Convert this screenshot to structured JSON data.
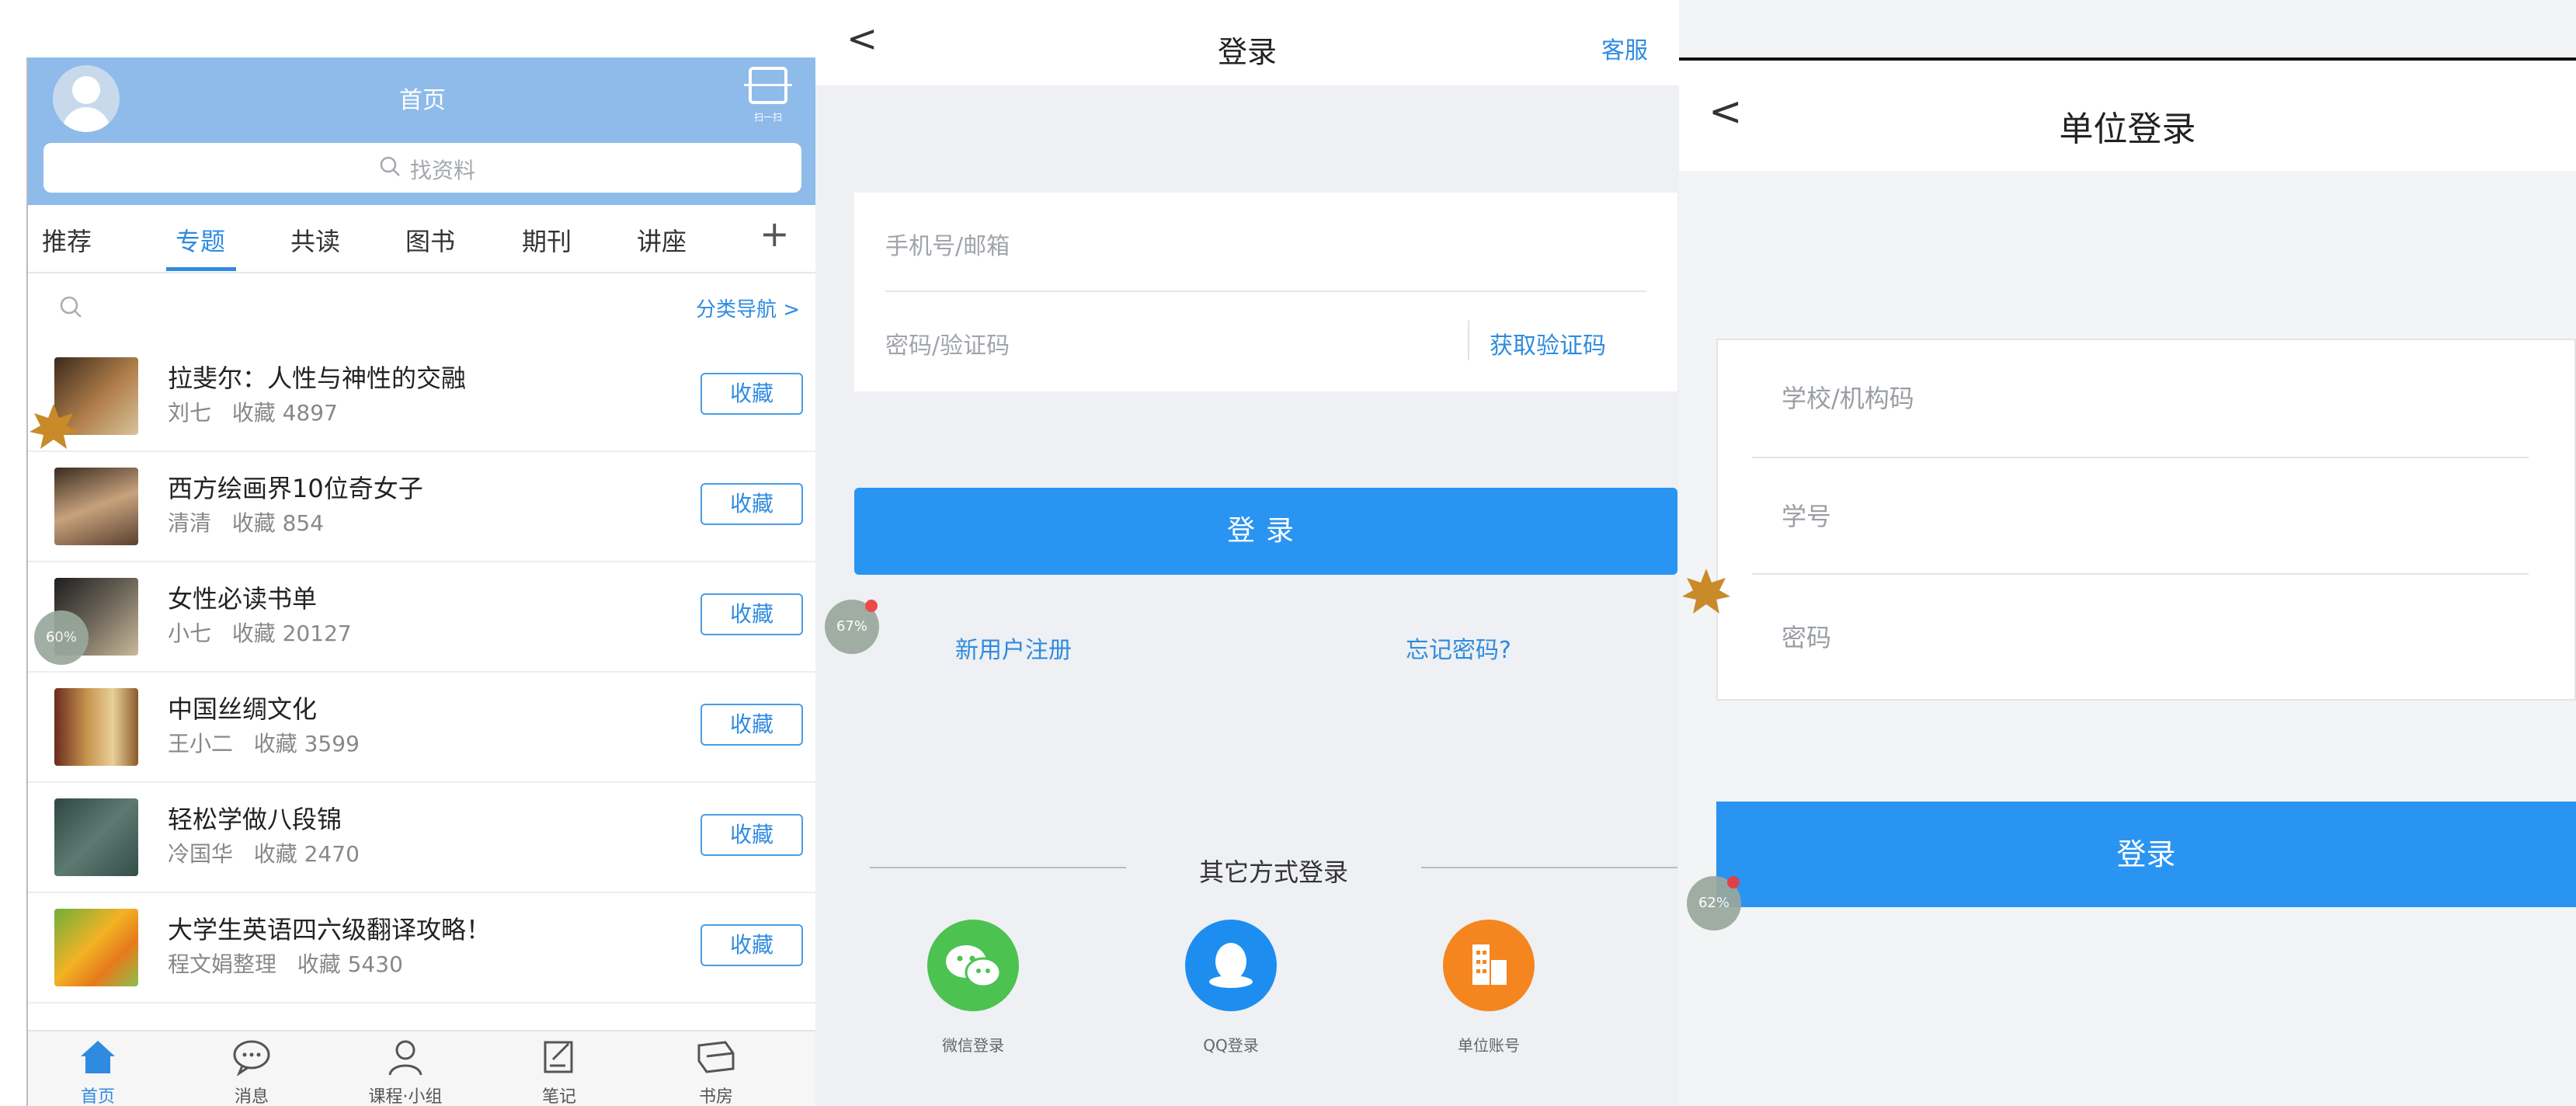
{
  "home": {
    "title": "首页",
    "scan_label": "扫一扫",
    "search_placeholder": "找资料",
    "tabs": [
      "推荐",
      "专题",
      "共读",
      "图书",
      "期刊",
      "讲座"
    ],
    "active_tab": "专题",
    "category_nav": "分类导航 >",
    "items": [
      {
        "title": "拉斐尔：人性与神性的交融",
        "author": "刘七",
        "favorites": "收藏 4897",
        "button": "收藏",
        "thumb_color": "#6b4a2e"
      },
      {
        "title": "西方绘画界10位奇女子",
        "author": "清清",
        "favorites": "收藏 854",
        "button": "收藏",
        "thumb_color": "#8a6b4c"
      },
      {
        "title": "女性必读书单",
        "author": "小七",
        "favorites": "收藏 20127",
        "button": "收藏",
        "thumb_color": "#3c3c3c"
      },
      {
        "title": "中国丝绸文化",
        "author": "王小二",
        "favorites": "收藏 3599",
        "button": "收藏",
        "thumb_color": "#9c6a3a"
      },
      {
        "title": "轻松学做八段锦",
        "author": "冷国华",
        "favorites": "收藏 2470",
        "button": "收藏",
        "thumb_color": "#3f5c56"
      },
      {
        "title": "大学生英语四六级翻译攻略！",
        "author": "程文娟整理",
        "favorites": "收藏 5430",
        "button": "收藏",
        "thumb_color": "#e6a02a"
      }
    ],
    "bottom_nav": [
      "首页",
      "消息",
      "课程·小组",
      "笔记",
      "书房"
    ],
    "bubble_text": "60%"
  },
  "login": {
    "back": "<",
    "title": "登录",
    "service": "客服",
    "phone_placeholder": "手机号/邮箱",
    "password_placeholder": "密码/验证码",
    "get_code": "获取验证码",
    "login_button": "登录",
    "register": "新用户注册",
    "forgot": "忘记密码?",
    "other_methods": "其它方式登录",
    "options": [
      {
        "label": "微信登录",
        "color": "#4cc250",
        "icon": "wechat-icon"
      },
      {
        "label": "QQ登录",
        "color": "#1d8ef0",
        "icon": "qq-icon"
      },
      {
        "label": "单位账号",
        "color": "#f5861f",
        "icon": "building-icon"
      }
    ],
    "bubble_text": "67%"
  },
  "unit_login": {
    "back": "<",
    "title": "单位登录",
    "school_placeholder": "学校/机构码",
    "id_placeholder": "学号",
    "password_placeholder": "密码",
    "login_button": "登录",
    "bubble_text": "62%"
  },
  "colors": {
    "accent": "#2a94f2",
    "header": "#8ebbea",
    "link": "#2f8be0"
  }
}
